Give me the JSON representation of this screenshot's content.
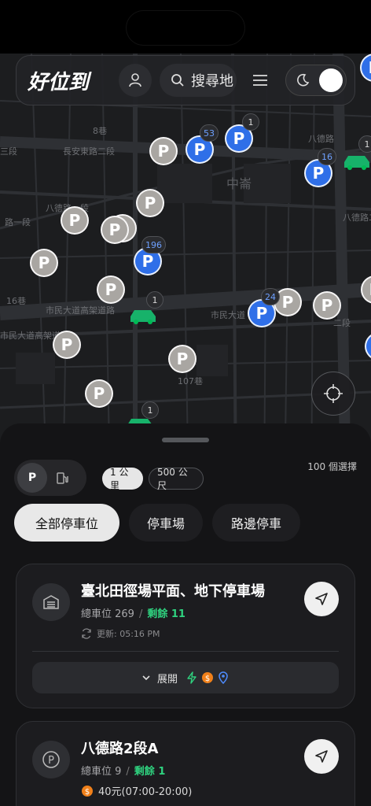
{
  "app": {
    "brand": "好位到"
  },
  "header": {
    "search_placeholder": "搜尋地",
    "icons": {
      "profile": "user-icon",
      "search": "search-icon",
      "menu": "hamburger-icon",
      "theme": "moon-icon"
    }
  },
  "map": {
    "district": "中崙",
    "streets": {
      "s1": "長安東路二段",
      "s2": "八德路一段",
      "s3": "市民大道高架道路",
      "s4": "市民大道",
      "s5": "八德路",
      "s6": "16巷",
      "s7": "107巷",
      "s8": "三段",
      "s9": "8巷",
      "s10": "路一段",
      "s11": "八德路二段",
      "s12": "二段"
    },
    "pin_label": "P",
    "badges": {
      "b1": "53",
      "b2": "1",
      "b3": "16",
      "b4": "196",
      "b5": "1",
      "b6": "24",
      "b7": "1",
      "b8": "1"
    }
  },
  "sheet": {
    "type_parking": "P",
    "type_fuel_icon": "gas-pump-icon",
    "dist_1": "1 公里",
    "dist_2": "500 公尺",
    "result_count": "100 個選擇",
    "filter_all": "全部停車位",
    "filter_lot": "停車場",
    "filter_street": "路邊停車"
  },
  "cards": {
    "c1": {
      "name": "臺北田徑場平面、地下停車場",
      "total": "總車位 269",
      "remaining": "剩餘 11",
      "updated": "更新: 05:16 PM",
      "expand": "展開"
    },
    "c2": {
      "name": "八德路2段A",
      "total": "總車位 9",
      "remaining": "剩餘 1",
      "price": "40元(07:00-20:00)"
    }
  },
  "colors": {
    "accent_green": "#2fd27f",
    "pin_blue": "#2f6fe8",
    "pin_gray": "#a9a6a2"
  }
}
